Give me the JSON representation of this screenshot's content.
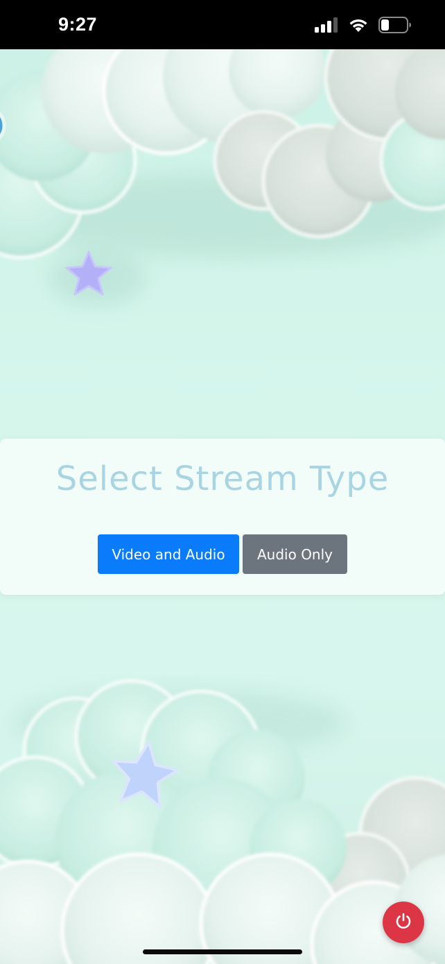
{
  "status_bar": {
    "time": "9:27",
    "icons": [
      "cellular-signal-icon",
      "wifi-icon",
      "battery-icon"
    ]
  },
  "card": {
    "title": "Select Stream Type",
    "buttons": {
      "video_audio": "Video and Audio",
      "audio_only": "Audio Only"
    }
  },
  "fab": {
    "icon": "power-icon"
  },
  "colors": {
    "primary": "#0a7cfb",
    "secondary": "#6c757d",
    "danger": "#dc3545",
    "title": "#a9d4e2",
    "background": "#d6f5ec"
  }
}
